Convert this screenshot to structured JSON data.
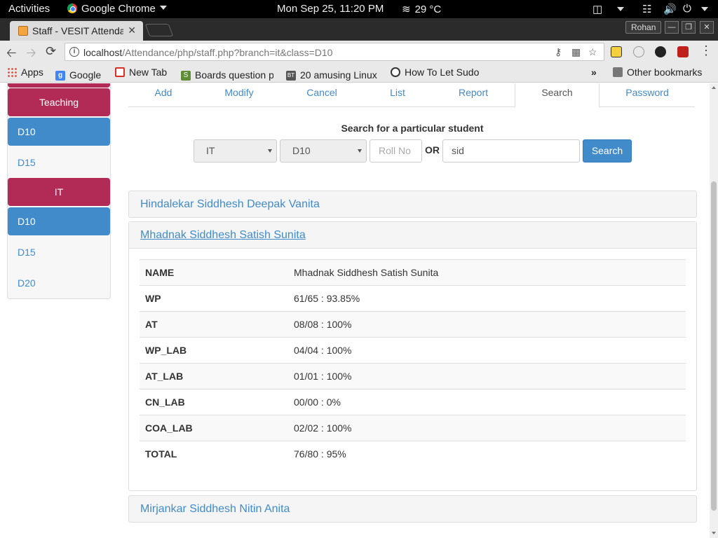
{
  "topbar": {
    "activities": "Activities",
    "app_name": "Google Chrome",
    "clock": "Mon Sep 25, 11:20 PM",
    "weather": "29 °C"
  },
  "browser": {
    "tab_title": "Staff - VESIT Attendance",
    "profile": "Rohan",
    "url_host": "localhost",
    "url_path": "/Attendance/php/staff.php?branch=it&class=D10"
  },
  "bookmarks": [
    {
      "label": "Apps",
      "icon": "apps-grid-icon"
    },
    {
      "label": "Google",
      "icon": "google-icon",
      "color": "#4285f4"
    },
    {
      "label": "New Tab",
      "icon": "gmail-icon",
      "color": "#d93025"
    },
    {
      "label": "Boards question p",
      "icon": "bookmark-s-icon",
      "color": "#5f8c36"
    },
    {
      "label": "20 amusing Linux",
      "icon": "bookmark-bt-icon",
      "color": "#555555"
    },
    {
      "label": "How To Let Sudo",
      "icon": "bookmark-web-icon",
      "color": "#333333"
    }
  ],
  "other_bookmarks": "Other bookmarks",
  "sidebar": {
    "items": [
      {
        "label": "Teaching",
        "kind": "head"
      },
      {
        "label": "D10",
        "kind": "active"
      },
      {
        "label": "D15",
        "kind": "link"
      },
      {
        "label": "IT",
        "kind": "head"
      },
      {
        "label": "D10",
        "kind": "active"
      },
      {
        "label": "D15",
        "kind": "link"
      },
      {
        "label": "D20",
        "kind": "link"
      }
    ]
  },
  "nav_tabs": [
    "Add",
    "Modify",
    "Cancel",
    "List",
    "Report",
    "Search",
    "Password"
  ],
  "active_tab": "Search",
  "search": {
    "title": "Search for a particular student",
    "branch": "IT",
    "class": "D10",
    "roll_placeholder": "Roll No",
    "or": "OR",
    "name_value": "sid",
    "button": "Search"
  },
  "students": [
    {
      "name": "Hindalekar Siddhesh Deepak Vanita"
    },
    {
      "name": "Mhadnak Siddhesh Satish Sunita"
    },
    {
      "name": "Mirjankar Siddhesh Nitin Anita"
    }
  ],
  "details": [
    {
      "key": "NAME",
      "value": "Mhadnak Siddhesh Satish Sunita"
    },
    {
      "key": "WP",
      "value": "61/65 : 93.85%"
    },
    {
      "key": "AT",
      "value": "08/08 : 100%"
    },
    {
      "key": "WP_LAB",
      "value": "04/04 : 100%"
    },
    {
      "key": "AT_LAB",
      "value": "01/01 : 100%"
    },
    {
      "key": "CN_LAB",
      "value": "00/00 : 0%"
    },
    {
      "key": "COA_LAB",
      "value": "02/02 : 100%"
    },
    {
      "key": "TOTAL",
      "value": "76/80 : 95%"
    }
  ],
  "colors": {
    "brand": "#b22b56",
    "primary": "#428bca"
  }
}
